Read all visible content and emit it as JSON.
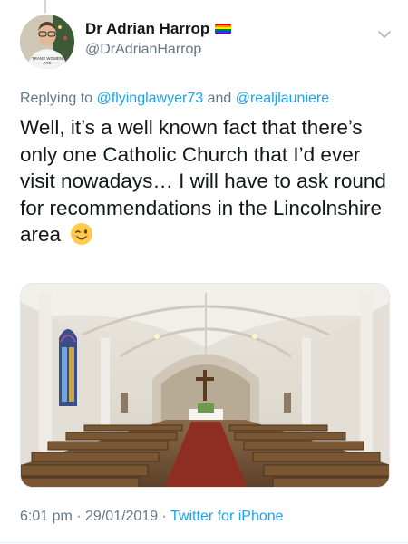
{
  "author": {
    "display_name": "Dr Adrian Harrop",
    "handle": "@DrAdrianHarrop",
    "badge_icon": "rainbow-flag-icon"
  },
  "reply": {
    "prefix": "Replying to ",
    "mention_1": "@flyinglawyer73",
    "joiner": " and ",
    "mention_2": "@realjlauniere"
  },
  "tweet": {
    "text": "Well, it’s a well known fact that there’s only one Catholic Church that I’d ever visit nowadays… I will have to ask round for recommendations in the Lincolnshire area",
    "emoji": "winking-face-icon"
  },
  "media": {
    "icon": "church-interior-photo"
  },
  "footer": {
    "time": "6:01 pm",
    "date": "29/01/2019",
    "separator": " · ",
    "source": "Twitter for iPhone"
  },
  "colors": {
    "link": "#1da1f2",
    "secondary_text": "#657786",
    "primary_text": "#14171a"
  }
}
